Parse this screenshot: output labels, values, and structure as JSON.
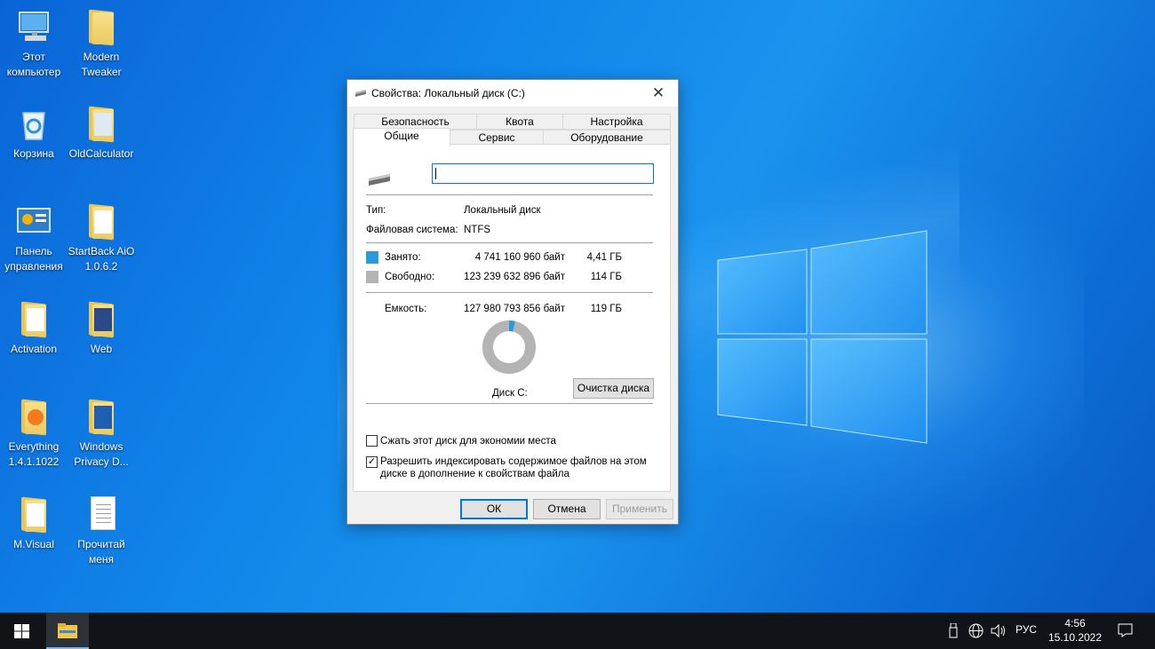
{
  "desktop": {
    "icons": [
      {
        "label": "Этот компьютер",
        "icon": "computer-icon"
      },
      {
        "label": "Modern Tweaker",
        "icon": "folder-icon"
      },
      {
        "label": "Корзина",
        "icon": "recycle-bin-icon"
      },
      {
        "label": "OldCalculator",
        "icon": "folder-icon"
      },
      {
        "label": "Панель управления",
        "icon": "control-panel-icon"
      },
      {
        "label": "StartBack AiO 1.0.6.2",
        "icon": "folder-icon"
      },
      {
        "label": "Activation",
        "icon": "folder-icon"
      },
      {
        "label": "Web",
        "icon": "folder-icon"
      },
      {
        "label": "Everything 1.4.1.1022",
        "icon": "folder-icon"
      },
      {
        "label": "Windows Privacy D...",
        "icon": "folder-icon"
      },
      {
        "label": "M.Visual",
        "icon": "folder-icon"
      },
      {
        "label": "Прочитай меня",
        "icon": "text-file-icon"
      }
    ]
  },
  "dialog": {
    "title": "Свойства: Локальный диск (C:)",
    "tabs_top": [
      "Безопасность",
      "Квота",
      "Настройка"
    ],
    "tabs_bottom": [
      "Общие",
      "Сервис",
      "Оборудование"
    ],
    "active_tab": "Общие",
    "name_value": "",
    "type_label": "Тип:",
    "type_value": "Локальный диск",
    "fs_label": "Файловая система:",
    "fs_value": "NTFS",
    "used": {
      "label": "Занято:",
      "bytes": "4 741 160 960 байт",
      "size": "4,41 ГБ",
      "color": "#2a9ad8"
    },
    "free": {
      "label": "Свободно:",
      "bytes": "123 239 632 896 байт",
      "size": "114 ГБ",
      "color": "#b4b4b4"
    },
    "capacity": {
      "label": "Емкость:",
      "bytes": "127 980 793 856 байт",
      "size": "119 ГБ"
    },
    "used_fraction": 0.037,
    "disk_label": "Диск C:",
    "cleanup_button": "Очистка диска",
    "compress_label": "Сжать этот диск для экономии места",
    "compress_checked": false,
    "index_label_1": "Разрешить индексировать содержимое файлов на этом",
    "index_label_2": "диске в дополнение к свойствам файла",
    "index_checked": true,
    "ok": "ОК",
    "cancel": "Отмена",
    "apply": "Применить"
  },
  "taskbar": {
    "language": "РУС",
    "time": "4:56",
    "date": "15.10.2022"
  }
}
